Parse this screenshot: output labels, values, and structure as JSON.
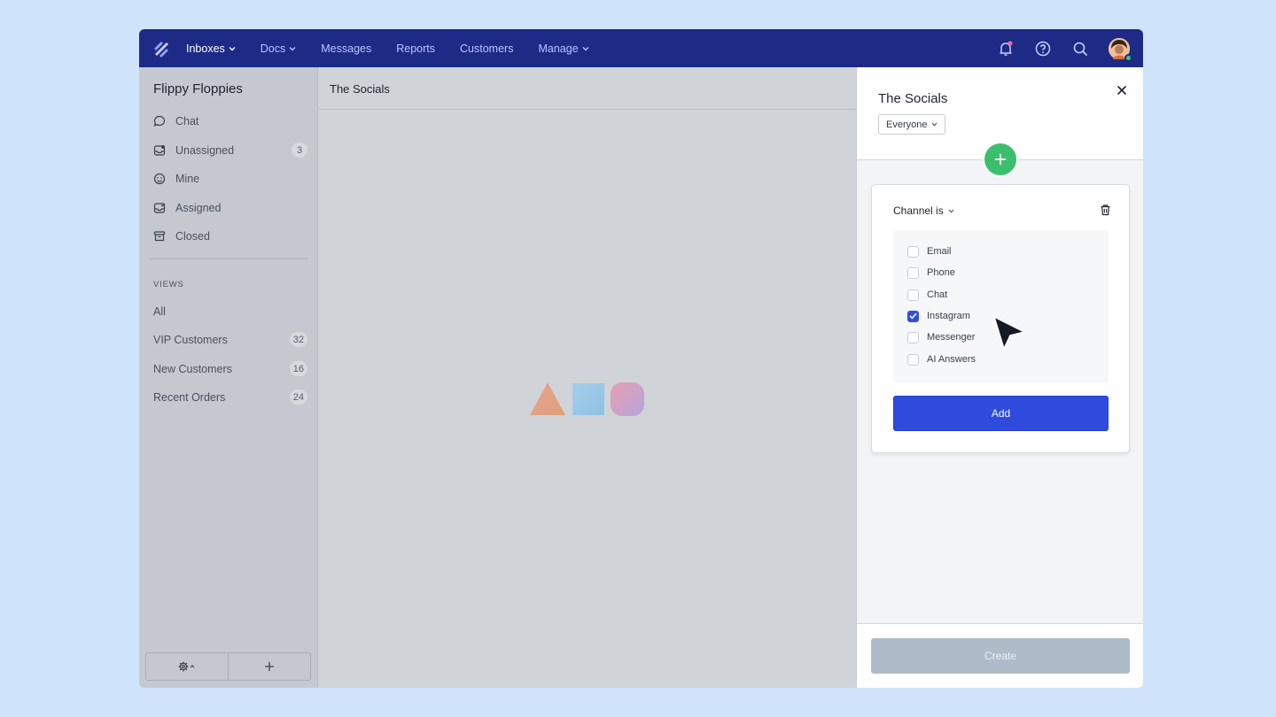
{
  "topbar": {
    "nav": [
      {
        "label": "Inboxes",
        "dropdown": true,
        "active": true
      },
      {
        "label": "Docs",
        "dropdown": true,
        "active": false
      },
      {
        "label": "Messages",
        "dropdown": false,
        "active": false
      },
      {
        "label": "Reports",
        "dropdown": false,
        "active": false
      },
      {
        "label": "Customers",
        "dropdown": false,
        "active": false
      },
      {
        "label": "Manage",
        "dropdown": true,
        "active": false
      }
    ],
    "icons": [
      "bell-icon",
      "help-icon",
      "search-icon",
      "avatar"
    ],
    "notification_dot_color": "#e86aa8",
    "brand_color": "#1d2a86"
  },
  "sidebar": {
    "title": "Flippy Floppies",
    "folders": [
      {
        "label": "Chat",
        "icon": "chat-bubble-icon",
        "count": ""
      },
      {
        "label": "Unassigned",
        "icon": "inbox-icon",
        "count": "3"
      },
      {
        "label": "Mine",
        "icon": "smiley-icon",
        "count": ""
      },
      {
        "label": "Assigned",
        "icon": "inbox-check-icon",
        "count": ""
      },
      {
        "label": "Closed",
        "icon": "archive-icon",
        "count": ""
      }
    ],
    "views_heading": "VIEWS",
    "views": [
      {
        "label": "All",
        "count": ""
      },
      {
        "label": "VIP Customers",
        "count": "32"
      },
      {
        "label": "New Customers",
        "count": "16"
      },
      {
        "label": "Recent Orders",
        "count": "24"
      }
    ]
  },
  "main": {
    "title": "The Socials"
  },
  "panel": {
    "title": "The Socials",
    "audience": "Everyone",
    "condition_label": "Channel is",
    "options": [
      {
        "label": "Email",
        "checked": false
      },
      {
        "label": "Phone",
        "checked": false
      },
      {
        "label": "Chat",
        "checked": false
      },
      {
        "label": "Instagram",
        "checked": true
      },
      {
        "label": "Messenger",
        "checked": false
      },
      {
        "label": "AI Answers",
        "checked": false
      }
    ],
    "add_label": "Add",
    "create_label": "Create",
    "accent_color": "#2e4bde",
    "plus_color": "#3cbf6c"
  }
}
